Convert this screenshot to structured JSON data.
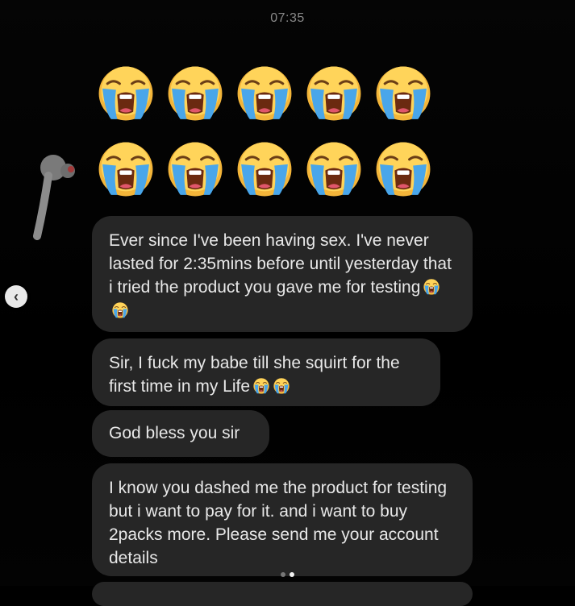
{
  "header": {
    "timestamp": "07:35"
  },
  "reaction_emoji": {
    "name": "loudly-crying-face-icon",
    "rows": 2,
    "per_row": 5
  },
  "messages": [
    {
      "text": "Ever since I've been having sex. I've never lasted for 2:35mins before until yesterday that i tried the product you gave me for testing",
      "trailing_emoji_count": 2
    },
    {
      "text": "Sir, I fuck my babe till she squirt for the first time in my Life",
      "trailing_emoji_count": 2
    },
    {
      "text": "God bless you sir",
      "trailing_emoji_count": 0
    },
    {
      "text": "I know you dashed me the product for testing but i want to pay for it. and i want to buy 2packs more. Please send me your account details",
      "trailing_emoji_count": 0
    }
  ],
  "carousel": {
    "total": 2,
    "active_index": 1,
    "prev_label": "‹"
  },
  "colors": {
    "background": "#000000",
    "bubble": "#262626",
    "bubble_text": "#e8e8e8",
    "timestamp": "#8a8a8a"
  }
}
